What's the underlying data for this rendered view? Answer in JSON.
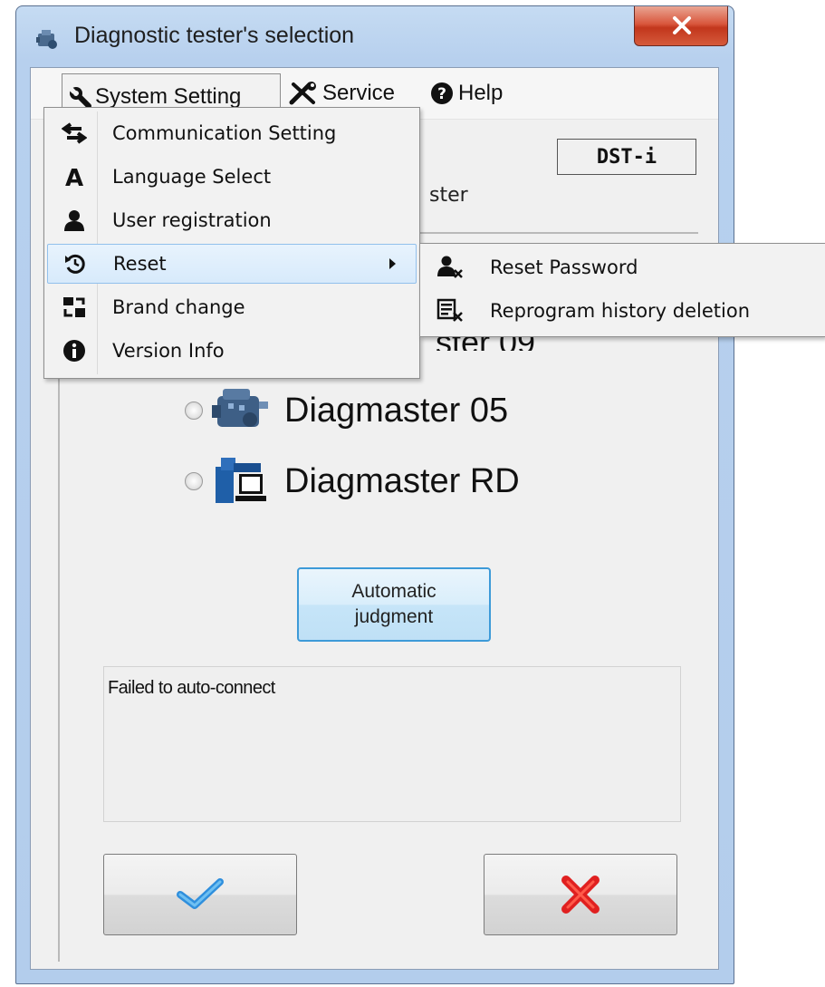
{
  "window": {
    "title": "Diagnostic tester's selection"
  },
  "menubar": {
    "items": [
      {
        "label": "System Setting",
        "icon": "wrench-icon"
      },
      {
        "label": "Service",
        "icon": "tools-icon"
      },
      {
        "label": "Help",
        "icon": "help-icon"
      }
    ]
  },
  "dropdown": {
    "items": [
      {
        "label": "Communication Setting",
        "icon": "arrows-swap-icon"
      },
      {
        "label": "Language Select",
        "icon": "letter-a-icon"
      },
      {
        "label": "User registration",
        "icon": "user-icon"
      },
      {
        "label": "Reset",
        "icon": "reset-icon",
        "has_submenu": true,
        "highlighted": true
      },
      {
        "label": "Brand change",
        "icon": "brand-change-icon"
      },
      {
        "label": "Version Info",
        "icon": "info-icon"
      }
    ]
  },
  "submenu": {
    "items": [
      {
        "label": "Reset Password",
        "icon": "user-delete-icon"
      },
      {
        "label": "Reprogram history deletion",
        "icon": "list-delete-icon"
      }
    ]
  },
  "dialog": {
    "tester_model": "DST-i",
    "partial_label": "ster",
    "partial_option": "ster 09",
    "options": [
      {
        "label": "Diagmaster 05",
        "icon": "engine-icon",
        "selected": false
      },
      {
        "label": "Diagmaster RD",
        "icon": "computer-icon",
        "selected": false
      }
    ],
    "auto_button": {
      "line1": "Automatic",
      "line2": "judgment"
    },
    "status_text": "Failed to auto-connect",
    "ok_icon": "checkmark-icon",
    "cancel_icon": "red-x-icon"
  },
  "colors": {
    "title_gradient": "#c5dbf2",
    "close_red": "#c2361c",
    "highlight": "#d7eafb",
    "check_blue": "#2f8fdd",
    "x_red": "#e02020"
  }
}
